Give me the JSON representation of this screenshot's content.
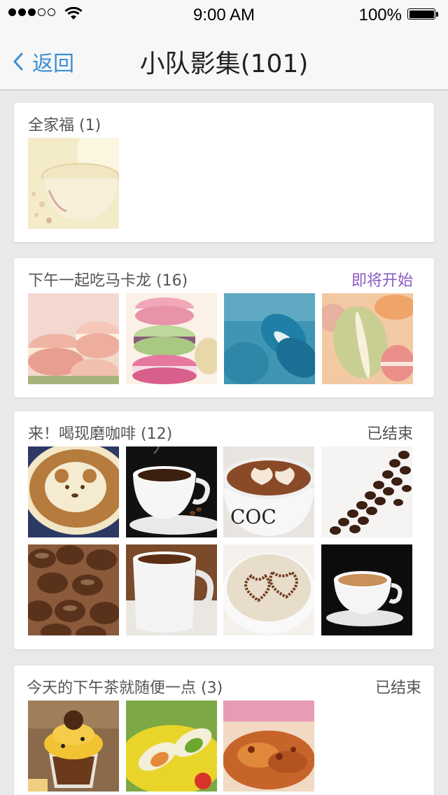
{
  "status_bar": {
    "time": "9:00 AM",
    "battery": "100%"
  },
  "nav": {
    "back_label": "返回",
    "title": "小队影集(101)"
  },
  "albums": [
    {
      "title": "全家福 (1)",
      "status": ""
    },
    {
      "title": "下午一起吃马卡龙 (16)",
      "status": "即将开始"
    },
    {
      "title": "来！喝现磨咖啡 (12)",
      "status": "已结束"
    },
    {
      "title": "今天的下午茶就随便一点 (3)",
      "status": "已结束"
    }
  ],
  "colors": {
    "accent": "#3a8fd6",
    "upcoming": "#8a5ac2",
    "background": "#e9e9e9"
  }
}
